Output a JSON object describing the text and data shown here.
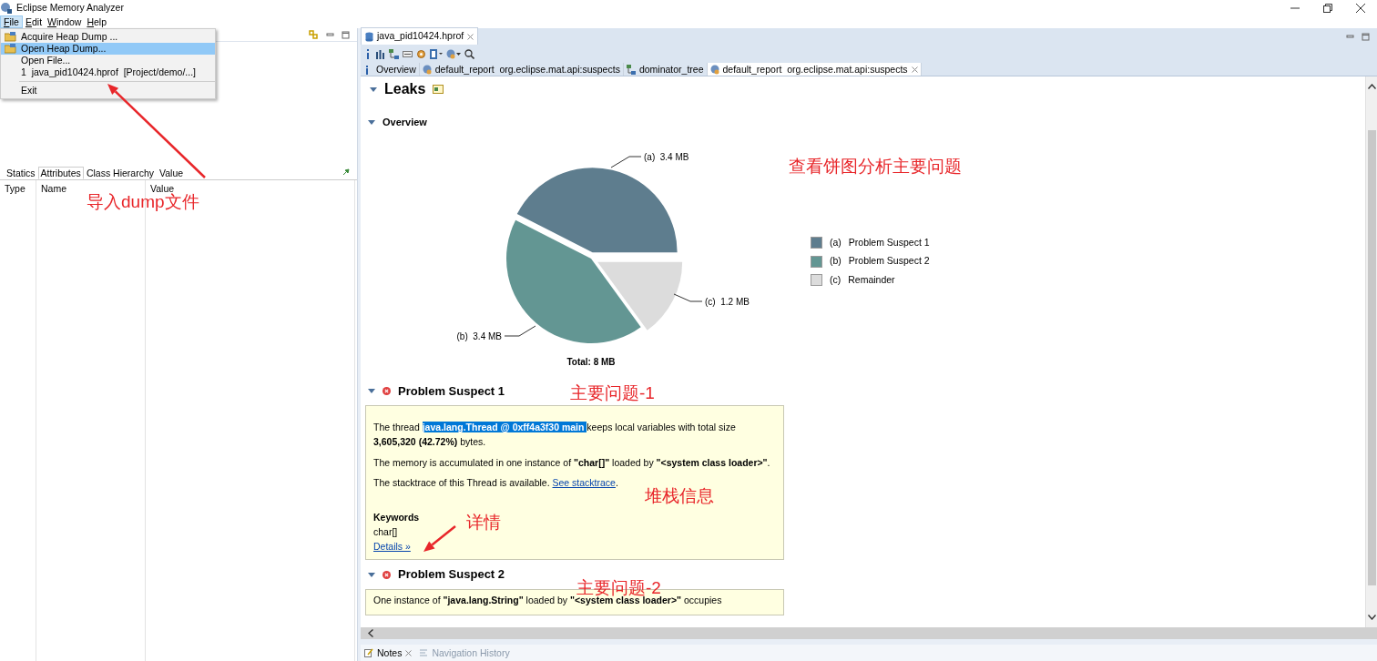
{
  "window": {
    "title": "Eclipse Memory Analyzer"
  },
  "menu_bar": [
    {
      "label": "File",
      "selected": true
    },
    {
      "label": "Edit",
      "selected": false
    },
    {
      "label": "Window",
      "selected": false
    },
    {
      "label": "Help",
      "selected": false
    }
  ],
  "file_menu": [
    {
      "kind": "item",
      "label": "Acquire Heap Dump ...",
      "icon": true,
      "selected": false
    },
    {
      "kind": "item",
      "label": "Open Heap Dump...",
      "icon": true,
      "selected": true
    },
    {
      "kind": "item",
      "label": "Open File...",
      "icon": false,
      "selected": false
    },
    {
      "kind": "item",
      "label": "1  java_pid10424.hprof  [Project/demo/...]",
      "icon": false,
      "selected": false
    },
    {
      "kind": "separator"
    },
    {
      "kind": "item",
      "label": "Exit",
      "icon": false,
      "selected": false
    }
  ],
  "inspector": {
    "tabs": [
      {
        "label": "Statics",
        "selected": false
      },
      {
        "label": "Attributes",
        "selected": true
      },
      {
        "label": "Class Hierarchy",
        "selected": false
      },
      {
        "label": "Value",
        "selected": false
      }
    ],
    "columns": [
      "Type",
      "Name",
      "Value"
    ]
  },
  "editor": {
    "tab": "java_pid10424.hprof",
    "sub_tabs": [
      {
        "label": "Overview",
        "selected": false
      },
      {
        "label": "default_report  org.eclipse.mat.api:suspects",
        "selected": false
      },
      {
        "label": "dominator_tree",
        "selected": false
      },
      {
        "label": "default_report  org.eclipse.mat.api:suspects",
        "selected": true
      }
    ]
  },
  "report": {
    "title": "Leaks",
    "overview": {
      "heading": "Overview",
      "chart_data": {
        "type": "pie",
        "title": "Total: 8 MB",
        "categories": [
          "Problem Suspect 1",
          "Problem Suspect 2",
          "Remainder"
        ],
        "values": [
          3.4,
          3.4,
          1.2
        ],
        "value_labels": [
          "(a)  3.4 MB",
          "(b)  3.4 MB",
          "(c)  1.2 MB"
        ]
      },
      "legend": [
        {
          "letter": "(a)",
          "color": "#5e7d8e"
        },
        {
          "letter": "(b)",
          "color": "#639693"
        },
        {
          "letter": "(c)",
          "color": "#dcdcdc"
        }
      ]
    },
    "suspects": [
      {
        "heading": "Problem Suspect 1",
        "paragraphs": [
          {
            "kind": "highlight",
            "before": "The thread ",
            "selected_text": "java.lang.Thread @ 0xff4a3f30 main ",
            "after": "keeps local variables with total size **3,605,320 (42.72%)** bytes."
          },
          {
            "kind": "plain",
            "text": "The memory is accumulated in one instance of **\"char[]\"** loaded by **\"<system class loader>\"**."
          },
          {
            "kind": "link",
            "text": "The stacktrace of this Thread is available. ",
            "link": "See stacktrace",
            "after": "."
          }
        ],
        "keywords_label": "Keywords",
        "keywords": "char[]",
        "details_link": "Details »"
      },
      {
        "heading": "Problem Suspect 2",
        "paragraphs": [
          {
            "kind": "plain",
            "text": "One instance of **\"java.lang.String\"** loaded by **\"<system class loader>\"** occupies"
          }
        ]
      }
    ]
  },
  "bottom_tabs": [
    {
      "label": "Notes",
      "selected": true
    },
    {
      "label": "Navigation History",
      "selected": false
    }
  ],
  "annotations": [
    {
      "text": "导入dump文件"
    },
    {
      "text": "查看饼图分析主要问题"
    },
    {
      "text": "主要问题-1"
    },
    {
      "text": "堆栈信息"
    },
    {
      "text": "详情"
    },
    {
      "text": "主要问题-2"
    }
  ]
}
